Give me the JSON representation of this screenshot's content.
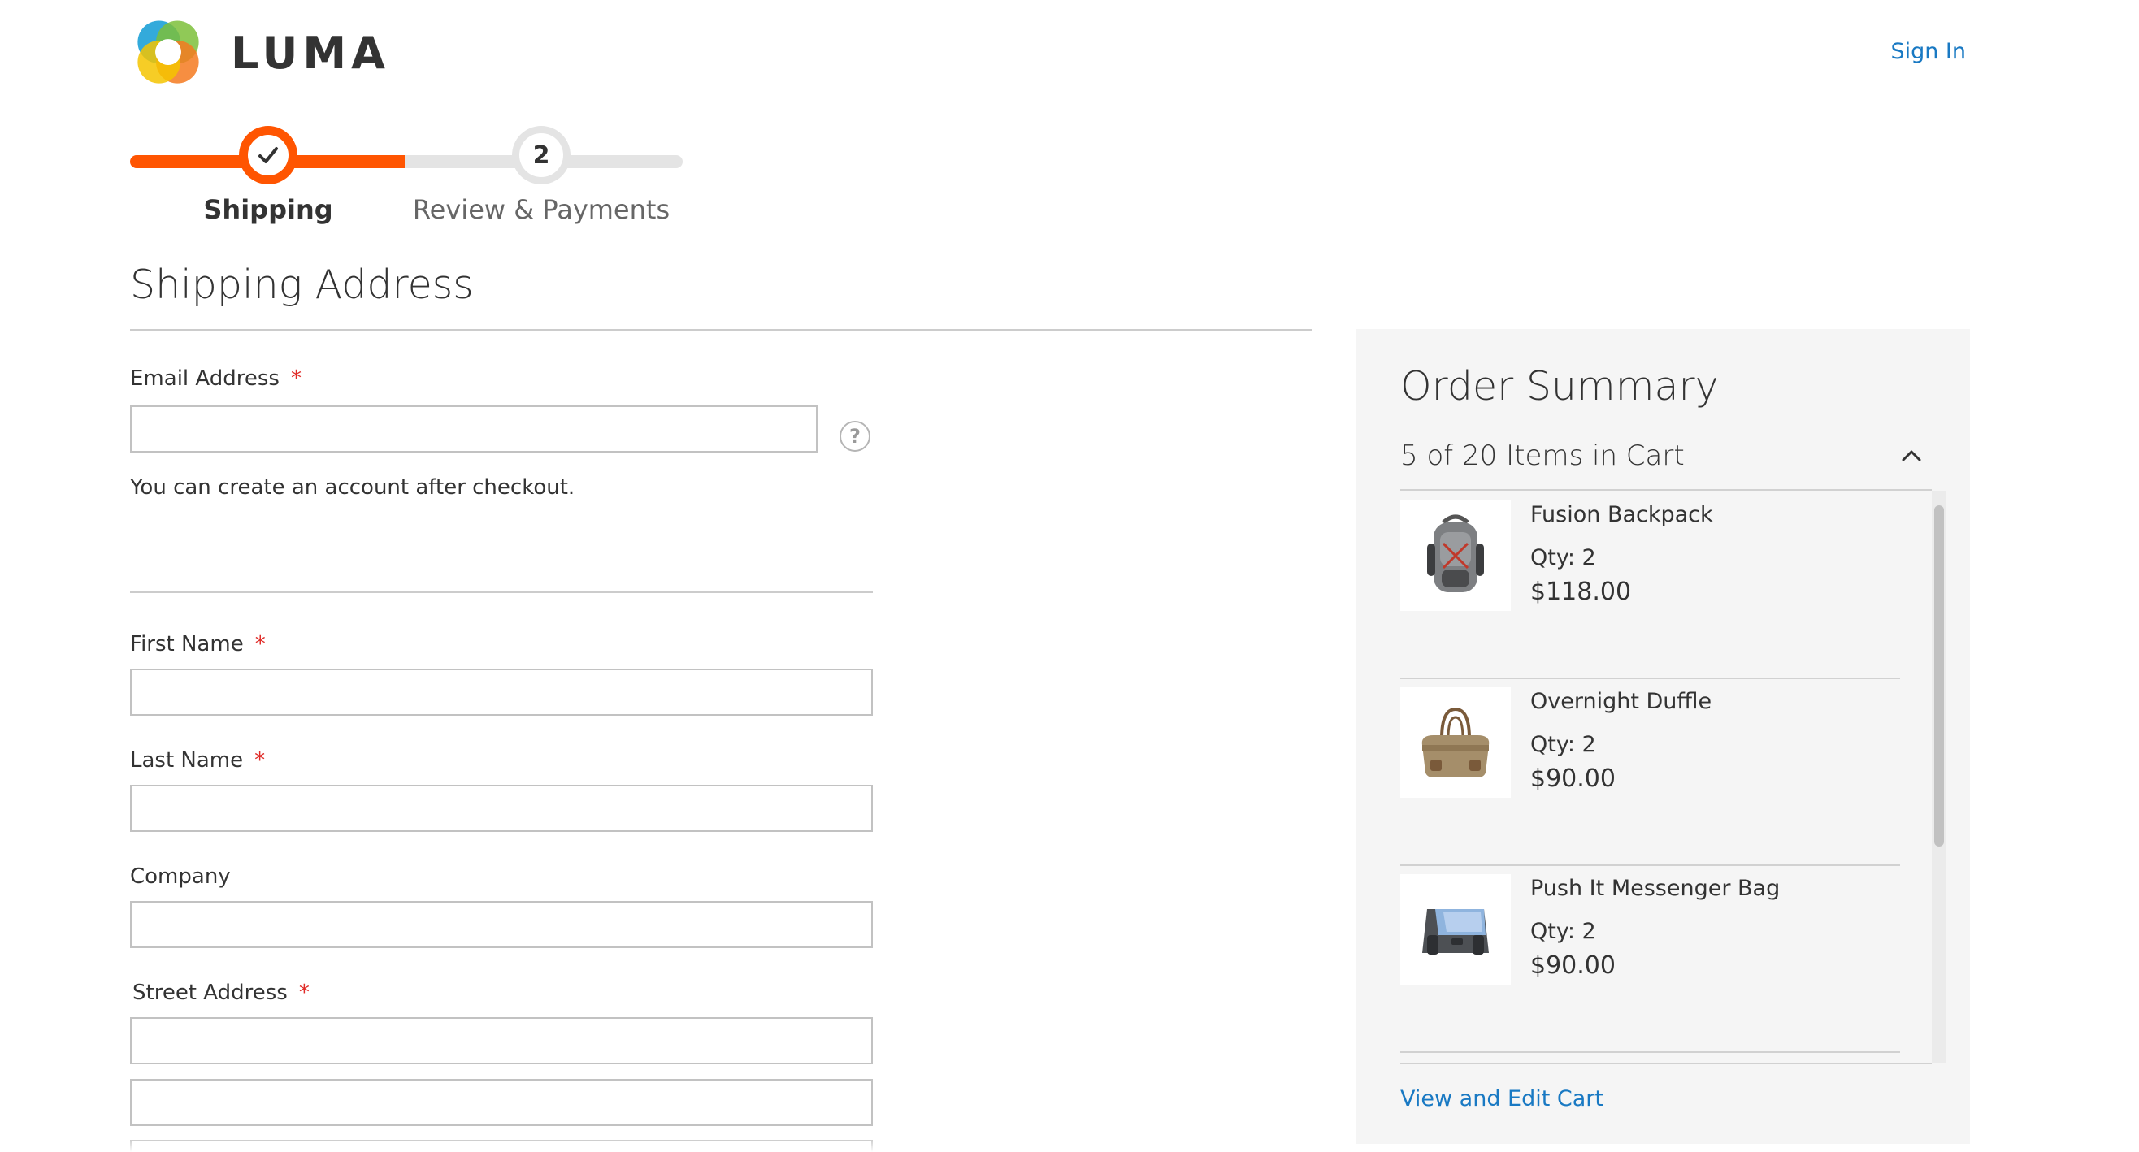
{
  "header": {
    "logo_text": "LUMA",
    "sign_in": "Sign In"
  },
  "progress": {
    "steps": [
      {
        "number": "",
        "label": "Shipping",
        "state": "complete"
      },
      {
        "number": "2",
        "label": "Review & Payments",
        "state": "upcoming"
      }
    ]
  },
  "shipping": {
    "title": "Shipping Address",
    "email": {
      "label": "Email Address",
      "required_mark": "*",
      "value": "",
      "placeholder": ""
    },
    "help_icon": "question-icon",
    "email_note": "You can create an account after checkout.",
    "first_name": {
      "label": "First Name",
      "required_mark": "*",
      "value": ""
    },
    "last_name": {
      "label": "Last Name",
      "required_mark": "*",
      "value": ""
    },
    "company": {
      "label": "Company",
      "value": ""
    },
    "street": {
      "label": "Street Address",
      "required_mark": "*",
      "line1": "",
      "line2": "",
      "line3": ""
    }
  },
  "summary": {
    "title": "Order Summary",
    "cart_count": "5 of 20 Items in Cart",
    "expanded": true,
    "items": [
      {
        "name": "Fusion Backpack",
        "qty": "Qty: 2",
        "price": "$118.00",
        "icon": "backpack-icon"
      },
      {
        "name": "Overnight Duffle",
        "qty": "Qty: 2",
        "price": "$90.00",
        "icon": "duffle-bag-icon"
      },
      {
        "name": "Push It Messenger Bag",
        "qty": "Qty: 2",
        "price": "$90.00",
        "icon": "messenger-bag-icon"
      }
    ],
    "view_edit_cart": "View and Edit Cart"
  },
  "colors": {
    "accent": "#ff5501",
    "link": "#1979c3",
    "required": "#e02b27",
    "summary_bg": "#f5f5f5"
  }
}
